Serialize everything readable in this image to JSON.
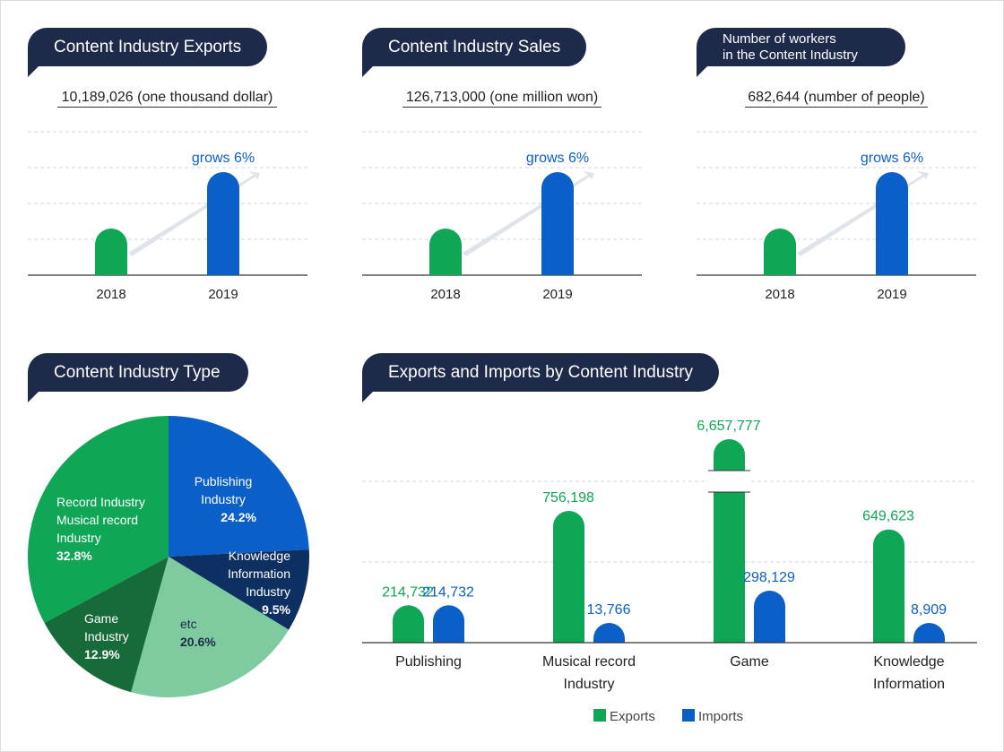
{
  "colors": {
    "green": "#0fa655",
    "blue": "#0b5fc8",
    "navy": "#1e2a4a",
    "dark_green": "#176a39",
    "light_green": "#7ecb9f",
    "dark_navy": "#0d2f61"
  },
  "panels": [
    {
      "title": "Content Industry Exports",
      "metric": "10,189,026 (one thousand dollar)"
    },
    {
      "title": "Content Industry Sales",
      "metric": "126,713,000 (one million won)"
    },
    {
      "title_line1": "Number of workers",
      "title_line2": "in the Content Industry",
      "metric": "682,644 (number of people)"
    }
  ],
  "pie_title": "Content Industry Type",
  "bar_title": "Exports and Imports by Content Industry",
  "chart_data": [
    {
      "type": "bar",
      "title": "Content Industry Exports",
      "categories": [
        "2018",
        "2019"
      ],
      "values": [
        52,
        115
      ],
      "annotation": "grows 6%"
    },
    {
      "type": "bar",
      "title": "Content Industry Sales",
      "categories": [
        "2018",
        "2019"
      ],
      "values": [
        52,
        115
      ],
      "annotation": "grows 6%"
    },
    {
      "type": "bar",
      "title": "Number of workers in the Content Industry",
      "categories": [
        "2018",
        "2019"
      ],
      "values": [
        52,
        115
      ],
      "annotation": "grows 6%"
    },
    {
      "type": "pie",
      "title": "Content Industry Type",
      "slices": [
        {
          "label_lines": [
            "Publishing",
            "Industry"
          ],
          "pct_label": "24.2%",
          "value": 24.2
        },
        {
          "label_lines": [
            "Knowledge",
            "Information",
            "Industry"
          ],
          "pct_label": "9.5%",
          "value": 9.5
        },
        {
          "label_lines": [
            "etc"
          ],
          "pct_label": "20.6%",
          "value": 20.6
        },
        {
          "label_lines": [
            "Game",
            "Industry"
          ],
          "pct_label": "12.9%",
          "value": 12.9
        },
        {
          "label_lines": [
            "Record Industry",
            "Musical record",
            "Industry"
          ],
          "pct_label": "32.8%",
          "value": 32.8
        }
      ]
    },
    {
      "type": "bar",
      "title": "Exports and Imports by Content Industry",
      "categories": [
        [
          "Publishing"
        ],
        [
          "Musical record",
          "Industry"
        ],
        [
          "Game"
        ],
        [
          "Knowledge",
          "Information"
        ]
      ],
      "series": [
        {
          "name": "Exports",
          "values": [
            214732,
            756198,
            6657777,
            649623
          ],
          "labels": [
            "214,732",
            "756,198",
            "6,657,777",
            "649,623"
          ]
        },
        {
          "name": "Imports",
          "values": [
            214732,
            13766,
            298129,
            8909
          ],
          "labels": [
            "214,732",
            "13,766",
            "298,129",
            "8,909"
          ]
        }
      ],
      "axis_break": "Game exports bar is truncated",
      "legend": "bottom-center"
    }
  ]
}
